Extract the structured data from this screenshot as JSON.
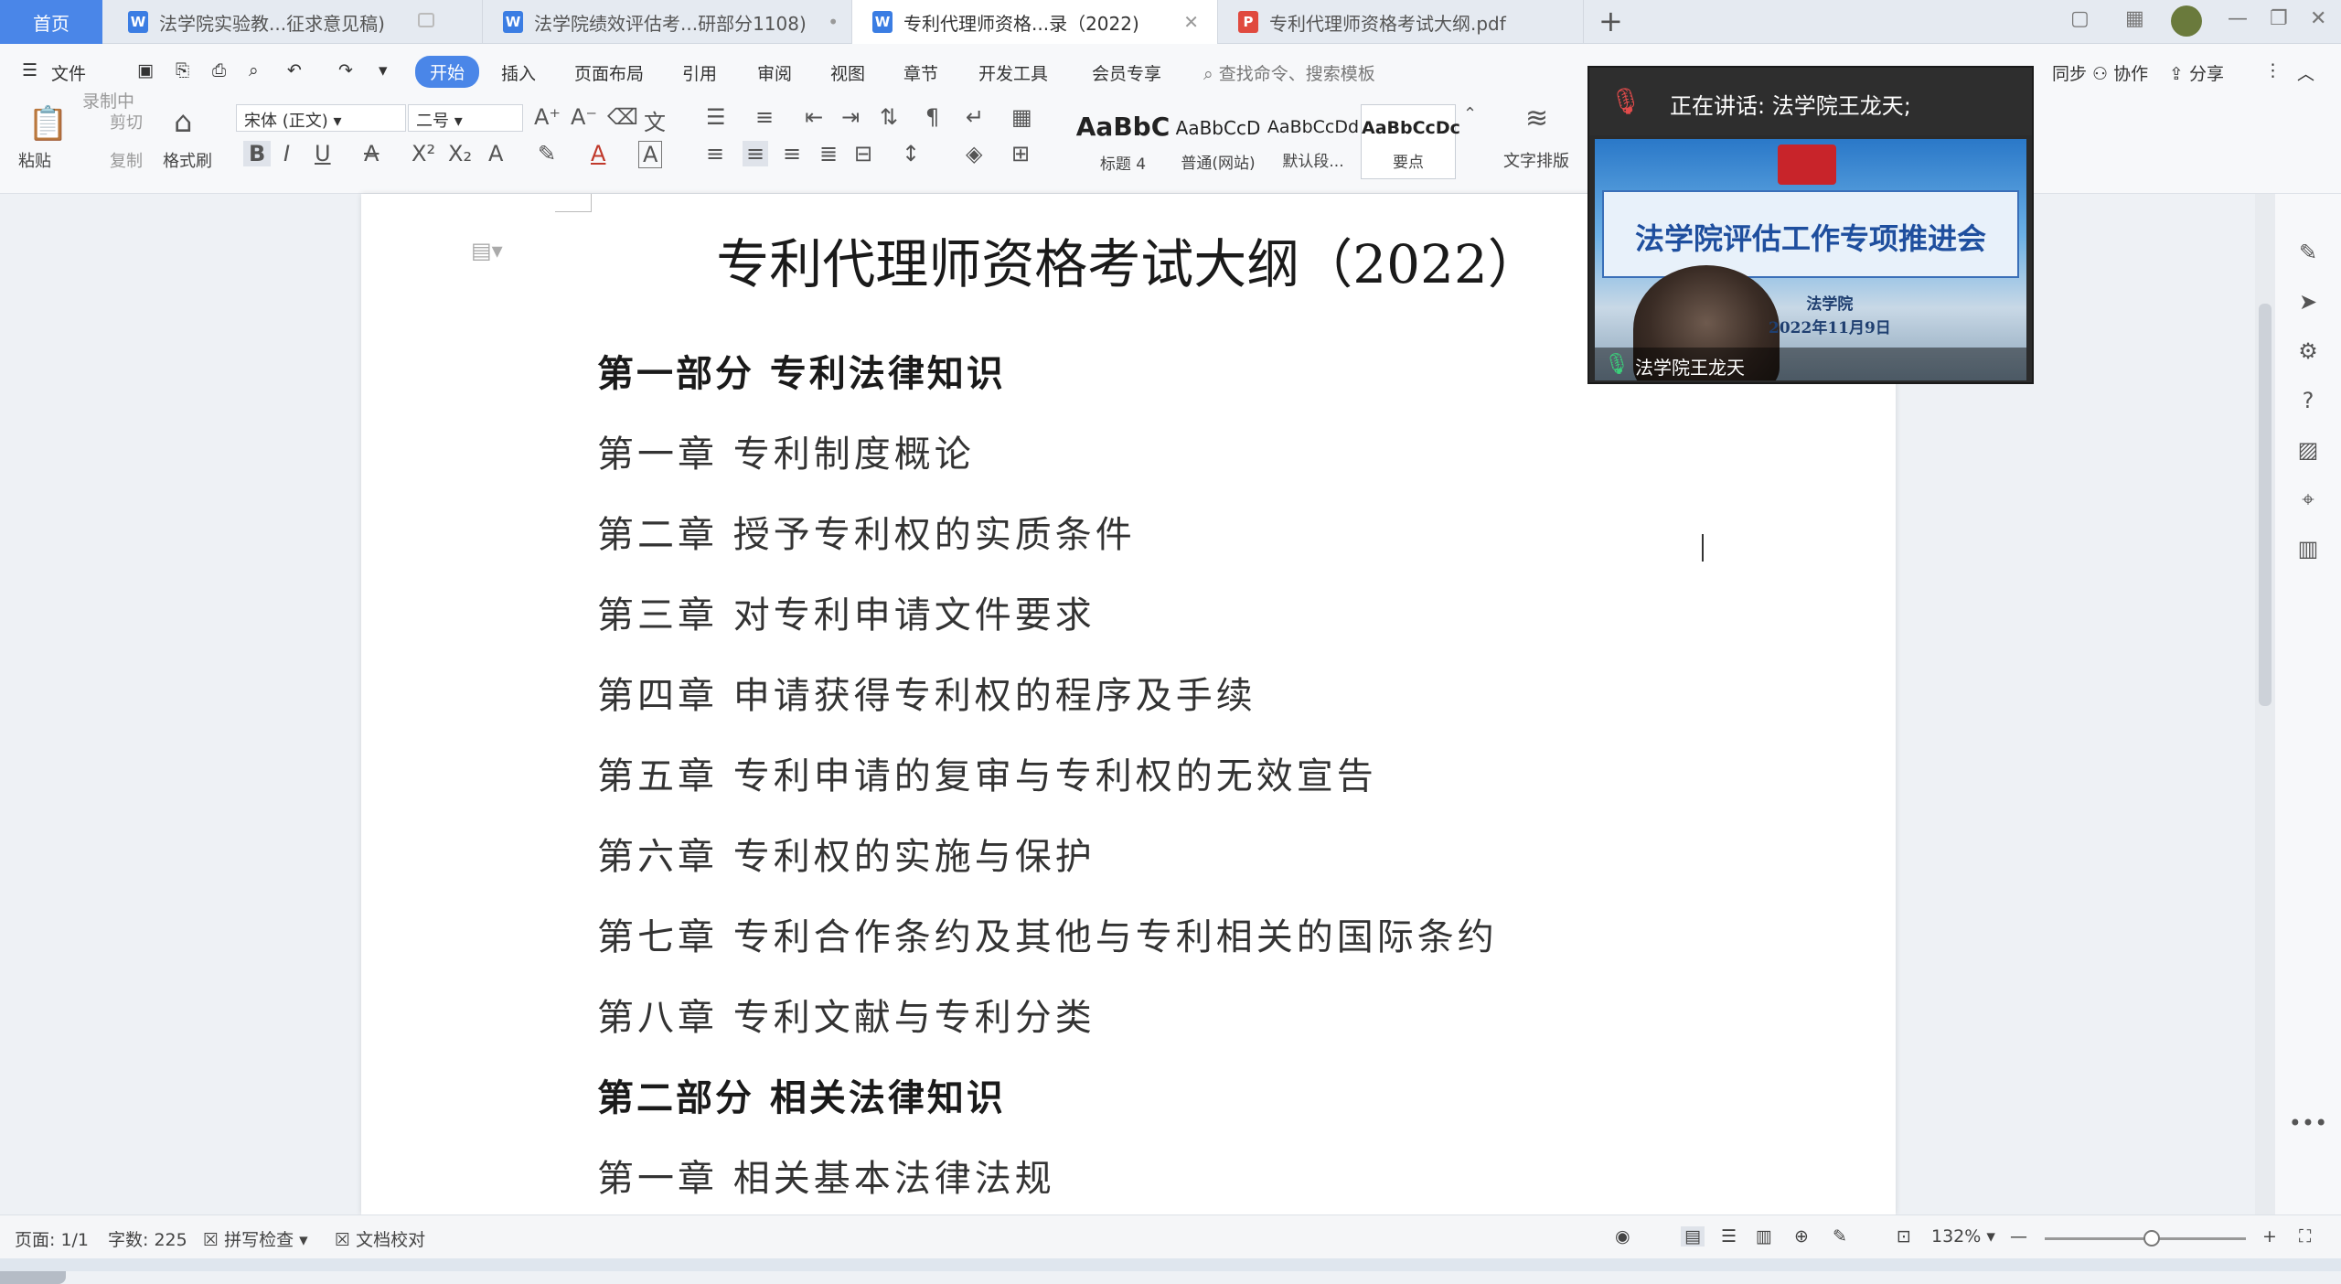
{
  "tabs": {
    "home": "首页",
    "items": [
      {
        "label": "法学院实验教...征求意见稿)",
        "icon": "W"
      },
      {
        "label": "法学院绩效评估考...研部分1108)",
        "icon": "W"
      },
      {
        "label": "专利代理师资格...录（2022)",
        "icon": "W"
      },
      {
        "label": "专利代理师资格考试大纲.pdf",
        "icon": "P"
      }
    ],
    "new_tab": "+"
  },
  "menu": {
    "file": "文件",
    "items": [
      "开始",
      "插入",
      "页面布局",
      "引用",
      "审阅",
      "视图",
      "章节",
      "开发工具",
      "会员专享"
    ],
    "search_placeholder": "查找命令、搜索模板",
    "sync": "同步",
    "collab": "协作",
    "share": "分享"
  },
  "ribbon": {
    "recording": "录制中",
    "paste": "粘贴",
    "cut": "剪切",
    "copy": "复制",
    "format_painter": "格式刷",
    "font_name": "宋体 (正文)",
    "font_size": "二号",
    "styles": [
      {
        "sample": "AaBbC",
        "label": "标题 4"
      },
      {
        "sample": "AaBbCcD",
        "label": "普通(网站)"
      },
      {
        "sample": "AaBbCcDd",
        "label": "默认段..."
      },
      {
        "sample": "AaBbCcDc",
        "label": "要点"
      }
    ],
    "text_layout": "文字排版"
  },
  "document": {
    "title": "专利代理师资格考试大纲（2022）",
    "lines": [
      {
        "text": "第一部分 专利法律知识",
        "part": true
      },
      {
        "text": "第一章 专利制度概论",
        "part": false
      },
      {
        "text": "第二章 授予专利权的实质条件",
        "part": false
      },
      {
        "text": "第三章 对专利申请文件要求",
        "part": false
      },
      {
        "text": "第四章 申请获得专利权的程序及手续",
        "part": false
      },
      {
        "text": "第五章 专利申请的复审与专利权的无效宣告",
        "part": false
      },
      {
        "text": "第六章 专利权的实施与保护",
        "part": false
      },
      {
        "text": "第七章 专利合作条约及其他与专利相关的国际条约",
        "part": false
      },
      {
        "text": "第八章 专利文献与专利分类",
        "part": false
      },
      {
        "text": "第二部分 相关法律知识",
        "part": true
      },
      {
        "text": "第一章 相关基本法律法规",
        "part": false
      }
    ]
  },
  "status": {
    "page": "页面: 1/1",
    "words": "字数: 225",
    "spell": "拼写检查",
    "proof": "文档校对",
    "zoom": "132%"
  },
  "video": {
    "speaking": "正在讲话: 法学院王龙天;",
    "banner_title": "法学院评估工作专项推进会",
    "banner_org": "法学院",
    "banner_date": "2022年11月9日",
    "participant": "法学院王龙天"
  },
  "colors": {
    "accent": "#4a86e8",
    "page_bg": "#eef1f5"
  }
}
